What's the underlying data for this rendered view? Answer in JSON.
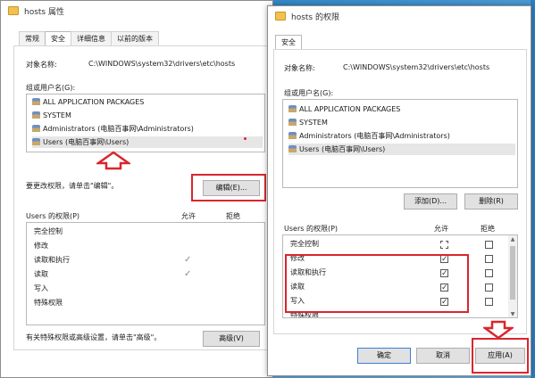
{
  "left_window": {
    "title": "hosts 属性",
    "tabs": [
      "常规",
      "安全",
      "详细信息",
      "以前的版本"
    ],
    "active_tab": "安全",
    "object_name_label": "对象名称:",
    "object_name_value": "C:\\WINDOWS\\system32\\drivers\\etc\\hosts",
    "groups_label": "组或用户名(G):",
    "groups": [
      "ALL APPLICATION PACKAGES",
      "SYSTEM",
      "Administrators (电脑百事网\\Administrators)",
      "Users (电脑百事网\\Users)"
    ],
    "selected_group_index": 3,
    "change_hint": "要更改权限，请单击\"编辑\"。",
    "edit_button": "编辑(E)...",
    "perm_header": "Users 的权限(P)",
    "allow_header": "允许",
    "deny_header": "拒绝",
    "permissions": [
      "完全控制",
      "修改",
      "读取和执行",
      "读取",
      "写入",
      "特殊权限"
    ],
    "allowed": [
      false,
      false,
      true,
      true,
      false,
      false
    ],
    "advanced_hint": "有关特殊权限或高级设置，请单击\"高级\"。",
    "advanced_button": "高级(V)"
  },
  "right_window": {
    "title": "hosts 的权限",
    "tab": "安全",
    "object_name_label": "对象名称:",
    "object_name_value": "C:\\WINDOWS\\system32\\drivers\\etc\\hosts",
    "groups_label": "组或用户名(G):",
    "groups": [
      "ALL APPLICATION PACKAGES",
      "SYSTEM",
      "Administrators (电脑百事网\\Administrators)",
      "Users (电脑百事网\\Users)"
    ],
    "selected_group_index": 3,
    "add_button": "添加(D)...",
    "remove_button": "删除(R)",
    "perm_header": "Users 的权限(P)",
    "allow_header": "允许",
    "deny_header": "拒绝",
    "permissions": [
      "完全控制",
      "修改",
      "读取和执行",
      "读取",
      "写入",
      "特殊权限"
    ],
    "allow_checked": [
      false,
      true,
      true,
      true,
      true,
      false
    ],
    "deny_checked": [
      false,
      false,
      false,
      false,
      false,
      false
    ],
    "ok_button": "确定",
    "cancel_button": "取消",
    "apply_button": "应用(A)"
  },
  "colors": {
    "highlight_red": "#d9262e",
    "desktop_blue": "#2d7fc2"
  }
}
